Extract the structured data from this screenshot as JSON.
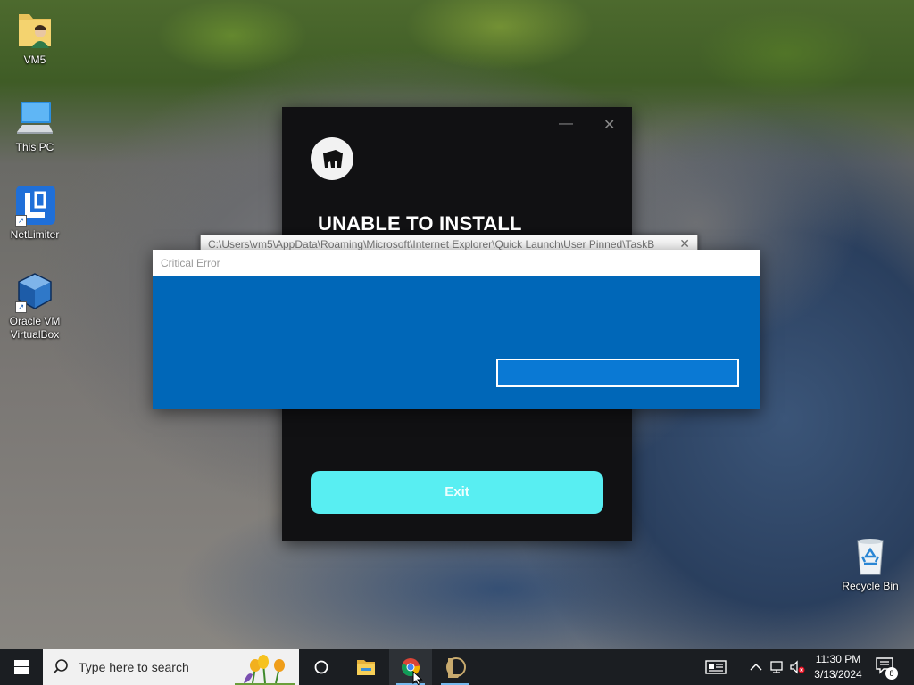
{
  "desktop": {
    "icons": [
      {
        "label": "VM5",
        "icon": "user-folder-icon"
      },
      {
        "label": "This PC",
        "icon": "computer-icon"
      },
      {
        "label": "NetLimiter",
        "icon": "netlimiter-icon"
      },
      {
        "label": "Oracle VM VirtualBox",
        "icon": "virtualbox-icon"
      },
      {
        "label": "Recycle Bin",
        "icon": "recycle-bin-icon"
      }
    ]
  },
  "installer": {
    "title": "UNABLE TO INSTALL",
    "exit_label": "Exit",
    "minimize_glyph": "—",
    "close_glyph": "✕",
    "accent": "#58eef2"
  },
  "path_window": {
    "path": "C:\\Users\\vm5\\AppData\\Roaming\\Microsoft\\Internet Explorer\\Quick Launch\\User Pinned\\TaskB",
    "close_glyph": "✕"
  },
  "critical_error": {
    "title": "Critical Error",
    "input_value": "",
    "body_color": "#0067b8"
  },
  "taskbar": {
    "search_placeholder": "Type here to search",
    "pinned": [
      "cortana-icon",
      "file-explorer-icon",
      "chrome-icon",
      "league-of-legends-icon"
    ],
    "time": "11:30 PM",
    "date": "3/13/2024",
    "notification_count": "8"
  }
}
